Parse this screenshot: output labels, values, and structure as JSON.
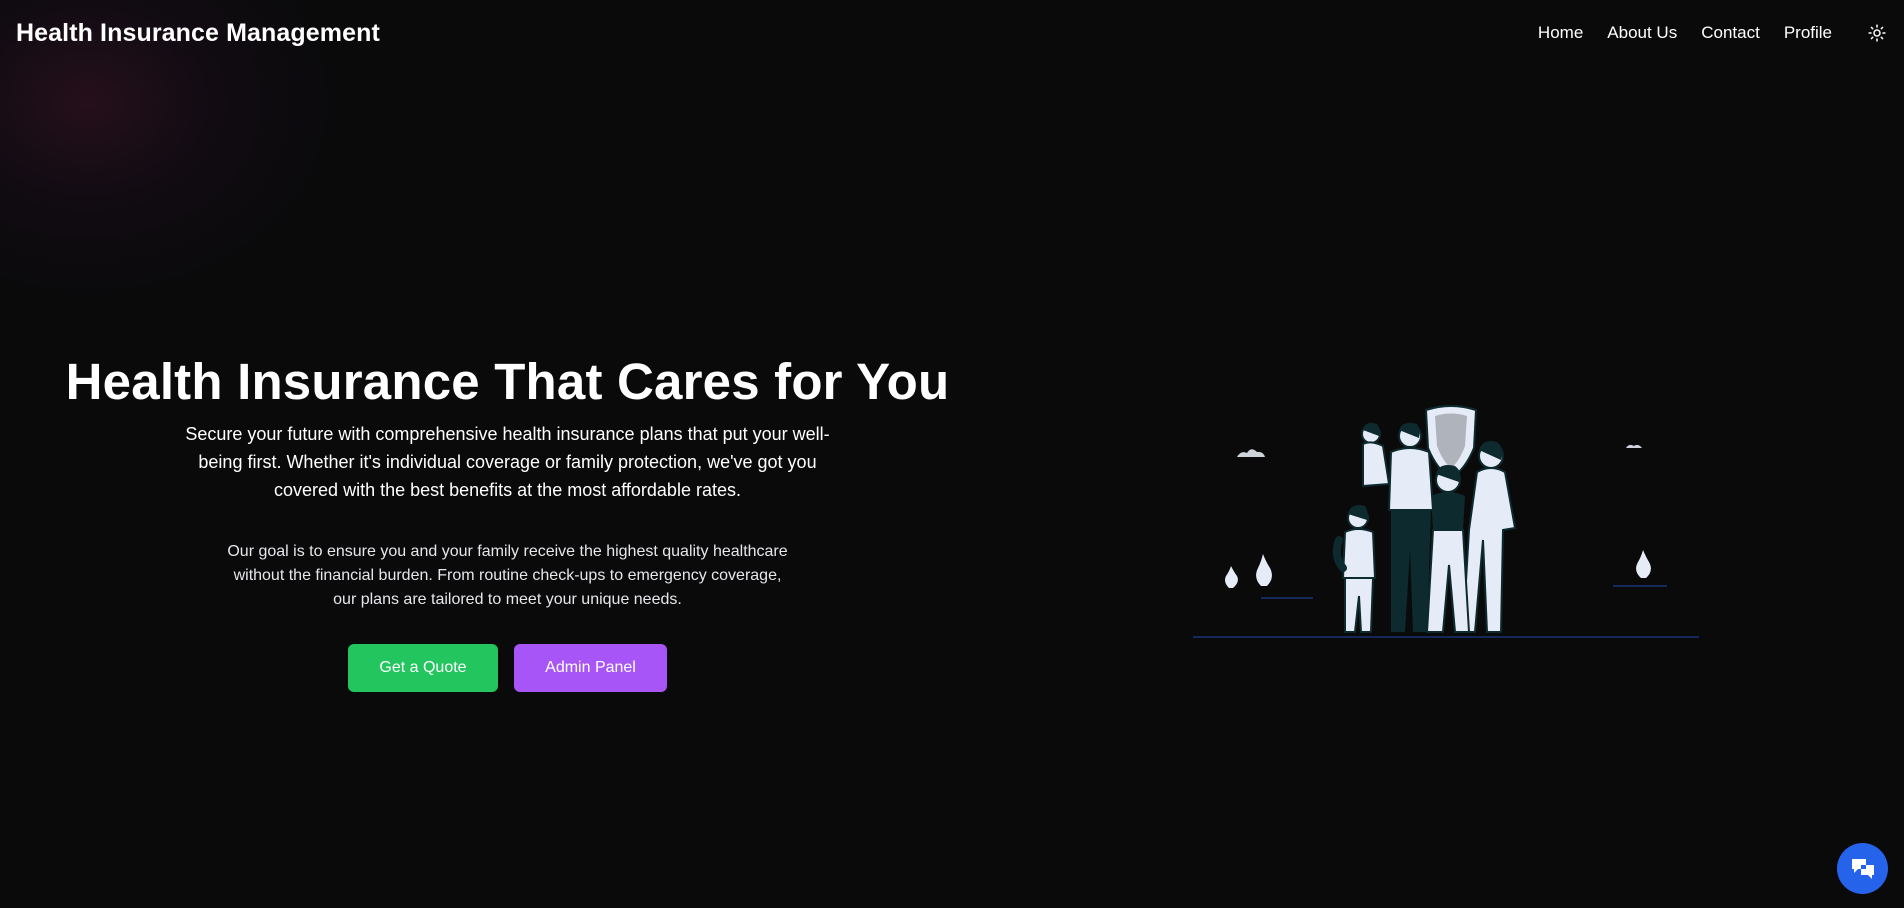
{
  "header": {
    "brand": "Health Insurance Management",
    "nav": [
      {
        "label": "Home"
      },
      {
        "label": "About Us"
      },
      {
        "label": "Contact"
      },
      {
        "label": "Profile"
      }
    ],
    "theme_icon": "sun-icon"
  },
  "hero": {
    "title": "Health Insurance That Cares for You",
    "subtitle": "Secure your future with comprehensive health insurance plans that put your well-being first. Whether it's individual coverage or family protection, we've got you covered with the best benefits at the most affordable rates.",
    "description": "Our goal is to ensure you and your family receive the highest quality healthcare without the financial burden. From routine check-ups to emergency coverage, our plans are tailored to meet your unique needs.",
    "primary_button": "Get a Quote",
    "secondary_button": "Admin Panel",
    "illustration_icon": "family-shield-illustration"
  },
  "chat": {
    "icon": "chat-icon"
  },
  "colors": {
    "background": "#0a0a0b",
    "primary_button": "#22c55e",
    "secondary_button": "#a855f7",
    "chat_button": "#2563eb",
    "illustration_fill": "#e6ecf7",
    "illustration_dark": "#0d2a2e"
  }
}
